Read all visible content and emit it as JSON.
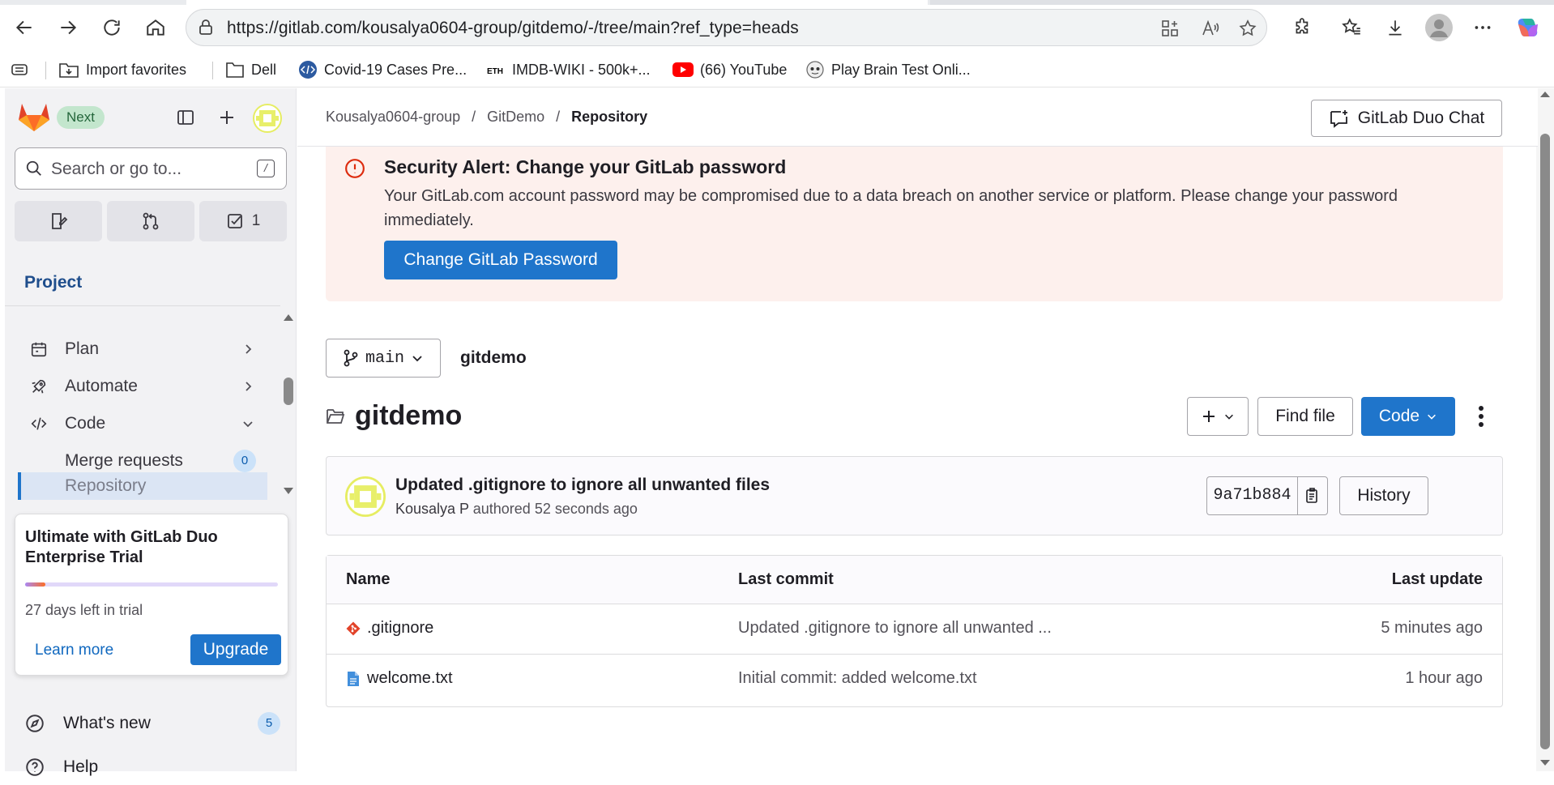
{
  "browser": {
    "url": "https://gitlab.com/kousalya0604-group/gitdemo/-/tree/main?ref_type=heads",
    "bookmarks": [
      "Import favorites",
      "Dell",
      "Covid-19 Cases Pre...",
      "IMDB-WIKI - 500k+...",
      "(66) YouTube",
      "Play Brain Test Onli..."
    ]
  },
  "sidebar": {
    "next_label": "Next",
    "search_placeholder": "Search or go to...",
    "search_shortcut": "/",
    "todo_count": "1",
    "section_title": "Project",
    "nav": {
      "plan": "Plan",
      "automate": "Automate",
      "code": "Code",
      "merge_requests": "Merge requests",
      "merge_requests_count": "0",
      "repository": "Repository"
    },
    "trial": {
      "title": "Ultimate with GitLab Duo Enterprise Trial",
      "days_left": "27 days left in trial",
      "progress_fraction": 0.08,
      "learn_more": "Learn more",
      "upgrade": "Upgrade"
    },
    "whats_new": "What's new",
    "whats_new_count": "5",
    "help": "Help"
  },
  "header": {
    "breadcrumbs": [
      "Kousalya0604-group",
      "/",
      "GitDemo",
      "/",
      "Repository"
    ],
    "duo_chat": "GitLab Duo Chat"
  },
  "alert": {
    "title": "Security Alert: Change your GitLab password",
    "message": "Your GitLab.com account password may be compromised due to a data breach on another service or platform. Please change your password immediately.",
    "button": "Change GitLab Password"
  },
  "repo": {
    "branch": "main",
    "path": "gitdemo",
    "title": "gitdemo",
    "find_file": "Find file",
    "code_button": "Code",
    "commit": {
      "message": "Updated .gitignore to ignore all unwanted files",
      "author": "Kousalya P",
      "action": "authored",
      "time": "52 seconds ago",
      "sha": "9a71b884",
      "history": "History"
    },
    "columns": [
      "Name",
      "Last commit",
      "Last update"
    ],
    "files": [
      {
        "name": ".gitignore",
        "last_commit": "Updated .gitignore to ignore all unwanted ...",
        "updated": "5 minutes ago"
      },
      {
        "name": "welcome.txt",
        "last_commit": "Initial commit: added welcome.txt",
        "updated": "1 hour ago"
      }
    ]
  },
  "colors": {
    "accent": "#1f75cb",
    "alert_bg": "#fdf0ed",
    "danger": "#dd2b0e",
    "gitlab_orange": "#fc6d26"
  }
}
